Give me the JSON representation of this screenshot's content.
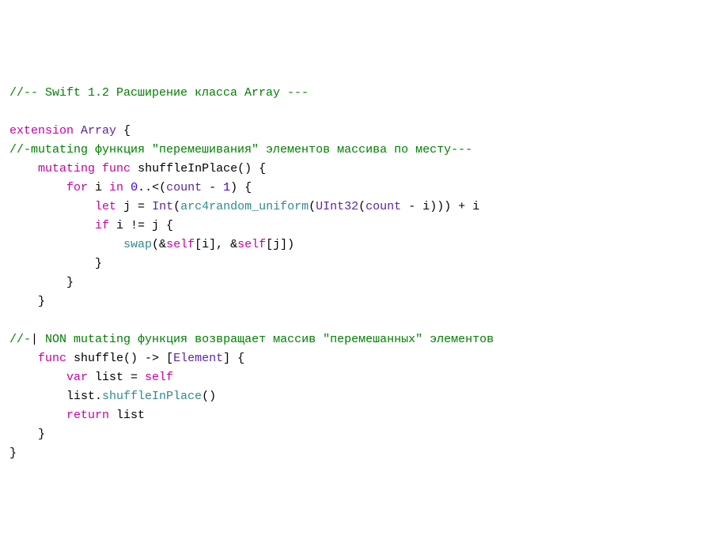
{
  "code": {
    "line1_comment": "//-- Swift 1.2 Расширение класса Array ---",
    "line3_kw1": "extension",
    "line3_type": "Array",
    "line3_brace": " {",
    "line4_comment": "//-mutating функция \"перемешивания\" элементов массива по месту---",
    "line5_indent": "    ",
    "line5_kw1": "mutating",
    "line5_kw2": "func",
    "line5_name": " shuffleInPlace() {",
    "line6_indent": "        ",
    "line6_kw": "for",
    "line6_text1": " i ",
    "line6_kw2": "in",
    "line6_text2": " ",
    "line6_num": "0",
    "line6_text3": "..<(",
    "line6_count": "count",
    "line6_text4": " - ",
    "line6_num2": "1",
    "line6_text5": ") {",
    "line7_indent": "            ",
    "line7_kw": "let",
    "line7_text1": " j = ",
    "line7_type1": "Int",
    "line7_text2": "(",
    "line7_func": "arc4random_uniform",
    "line7_text3": "(",
    "line7_type2": "UInt32",
    "line7_text4": "(",
    "line7_count": "count",
    "line7_text5": " - i))) + i",
    "line8_indent": "            ",
    "line8_kw": "if",
    "line8_text": " i != j {",
    "line9_indent": "                ",
    "line9_func": "swap",
    "line9_text1": "(&",
    "line9_self1": "self",
    "line9_text2": "[i], &",
    "line9_self2": "self",
    "line9_text3": "[j])",
    "line10": "            }",
    "line11": "        }",
    "line12": "    }",
    "line14_comment_prefix": "//-",
    "line14_cursor": "|",
    "line14_comment_rest": " NON mutating функция возвращает массив \"перемешанных\" элементов",
    "line15_indent": "    ",
    "line15_kw": "func",
    "line15_name": " shuffle() -> [",
    "line15_type": "Element",
    "line15_text": "] {",
    "line16_indent": "        ",
    "line16_kw": "var",
    "line16_text": " list = ",
    "line16_self": "self",
    "line17_indent": "        ",
    "line17_text1": "list.",
    "line17_func": "shuffleInPlace",
    "line17_text2": "()",
    "line18_indent": "        ",
    "line18_kw": "return",
    "line18_text": " list",
    "line19": "    }",
    "line20": "}"
  }
}
